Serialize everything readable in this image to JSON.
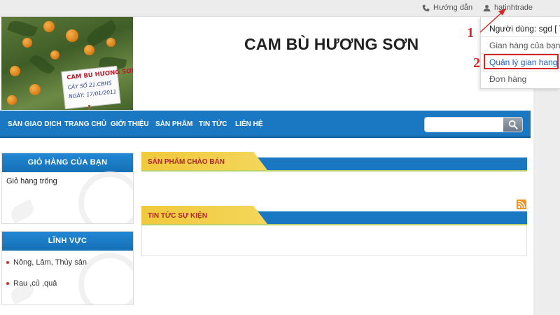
{
  "topbar": {
    "guide_label": "Hướng dẫn",
    "username": "hatinhtrade"
  },
  "header": {
    "site_title": "CAM BÙ HƯƠNG SƠN",
    "banner_sign": {
      "line1": "CAM BÙ HƯƠNG SƠN",
      "line2": "CÂY SỐ 21.CBHS",
      "line3": "NGÀY: 17/01/2011"
    }
  },
  "nav": {
    "items": [
      "SÀN GIAO DỊCH",
      "TRANG CHỦ",
      "GIỚI THIỆU",
      "SẢN PHẨM",
      "TIN TỨC",
      "LIÊN HỆ"
    ],
    "search_value": ""
  },
  "sidebar": {
    "cart": {
      "title": "GIỎ HÀNG CỦA BẠN",
      "empty_text": "Giỏ hàng trống"
    },
    "categories": {
      "title": "LĨNH VỰC",
      "items": [
        "Nông, Lâm, Thủy sản",
        "Rau ,củ ,quả"
      ]
    }
  },
  "main": {
    "offers_title": "SẢN PHẨM CHÀO BÁN",
    "news_title": "TIN TỨC SỰ KIỆN"
  },
  "user_menu": {
    "user_line": "Người dùng: sgd [ Th",
    "items": [
      "Gian hàng của bạn",
      "Quản lý gian hang",
      "Đơn hàng"
    ],
    "highlighted_index": 1
  },
  "annotations": {
    "step1": "1",
    "step2": "2",
    "color": "#d42424"
  },
  "colors": {
    "nav_blue": "#1a78c2",
    "tab_yellow": "#f0c93c",
    "panel_title_red": "#b2262a"
  }
}
